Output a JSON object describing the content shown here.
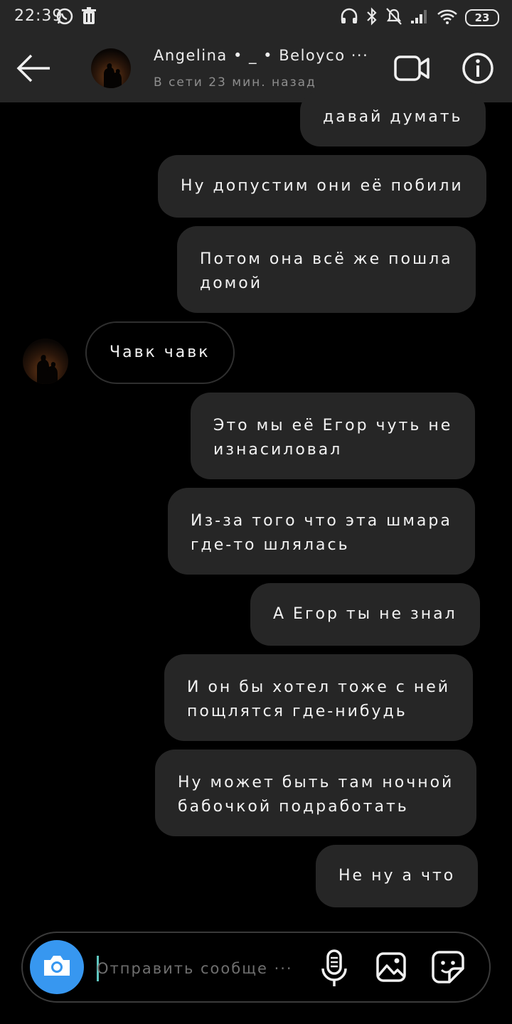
{
  "status_bar": {
    "time": "22:39",
    "battery": "23"
  },
  "header": {
    "name": "Angelina • _ • Beloyco ···",
    "status": "В сети 23 мин. назад"
  },
  "messages": [
    {
      "text": "давай думать",
      "direction": "outgoing"
    },
    {
      "text": "Ну допустим они её побили",
      "direction": "outgoing"
    },
    {
      "text": "Потом она всё же пошла",
      "text2": "домой",
      "direction": "outgoing"
    },
    {
      "text": "Чавк чавк",
      "direction": "incoming"
    },
    {
      "text": "Это мы её Егор чуть не",
      "text2": "изнасиловал",
      "direction": "outgoing"
    },
    {
      "text": "Из-за того что эта шмара",
      "text2": "где-то шлялась",
      "direction": "outgoing"
    },
    {
      "text": "А Егор ты не знал",
      "direction": "outgoing"
    },
    {
      "text": "И он бы хотел тоже с ней",
      "text2": "пощлятся где-нибудь",
      "direction": "outgoing"
    },
    {
      "text": "Ну может быть там ночной",
      "text2": "бабочкой подработать",
      "direction": "outgoing"
    },
    {
      "text": "Не ну а что",
      "direction": "outgoing"
    }
  ],
  "composer": {
    "placeholder": "Отправить сообще ···"
  },
  "colors": {
    "header_bg": "#262626",
    "bubble_bg": "#262626",
    "accent": "#3797f0"
  },
  "icons": [
    "whatsapp-icon",
    "trash-icon",
    "headphones-icon",
    "bluetooth-icon",
    "mute-icon",
    "signal-icon",
    "wifi-icon",
    "back-arrow-icon",
    "video-call-icon",
    "info-icon",
    "camera-icon",
    "microphone-icon",
    "gallery-icon",
    "sticker-icon"
  ]
}
